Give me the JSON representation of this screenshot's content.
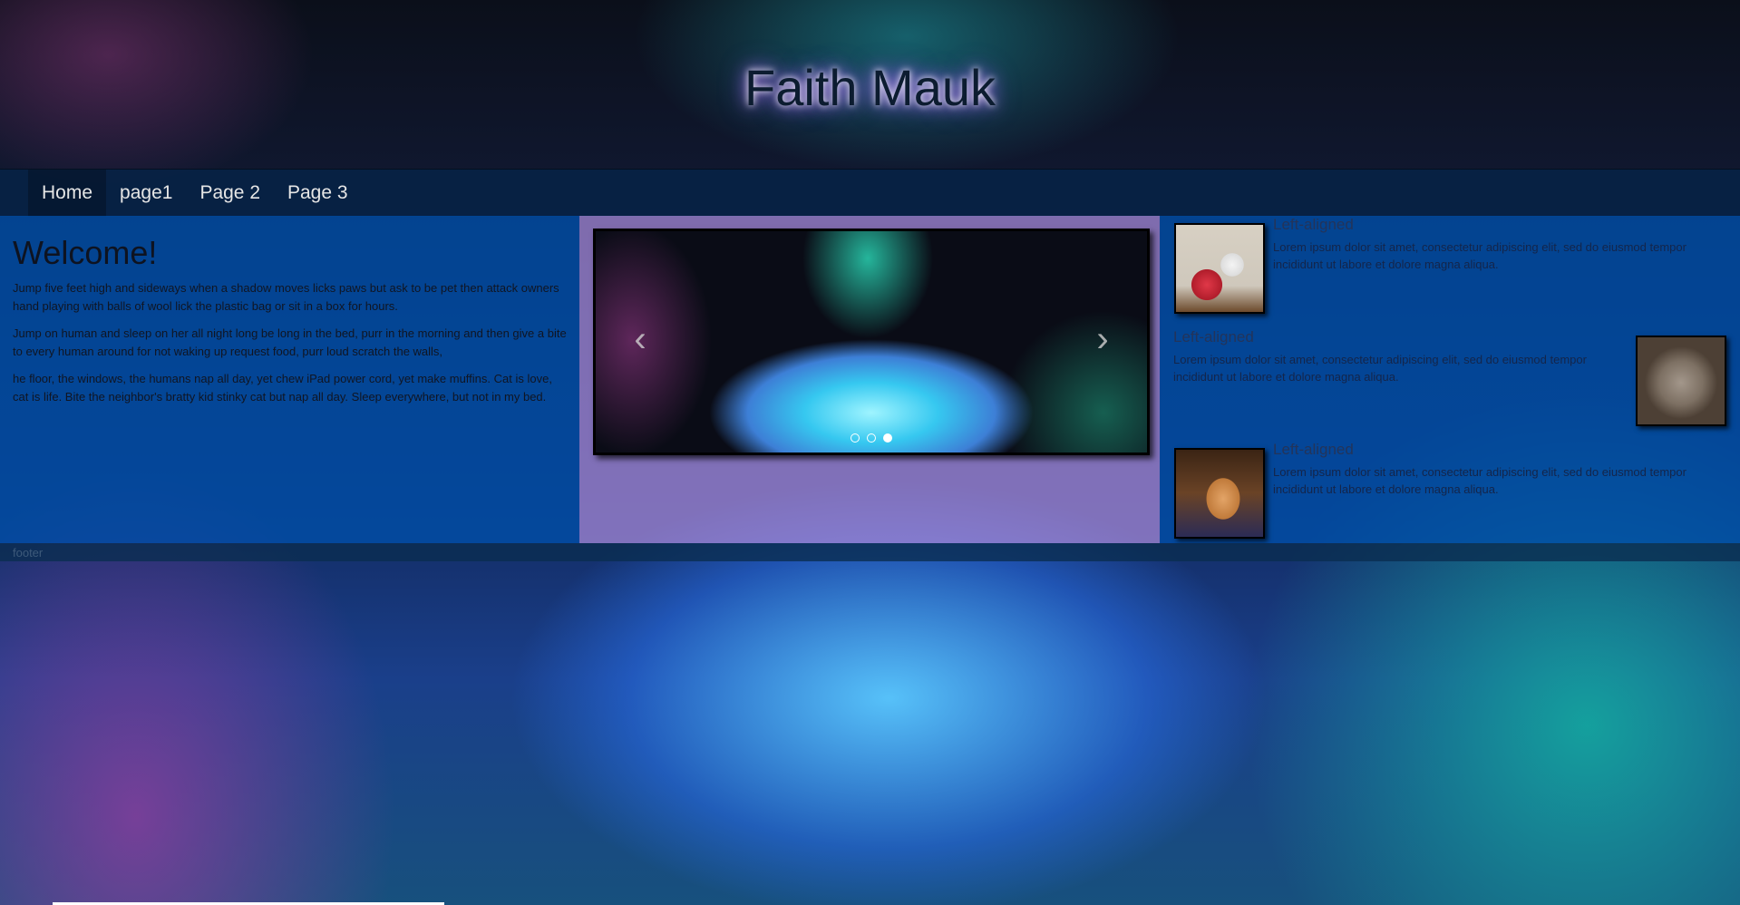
{
  "header": {
    "title": "Faith Mauk"
  },
  "nav": {
    "items": [
      {
        "label": "Home",
        "active": true
      },
      {
        "label": "page1",
        "active": false
      },
      {
        "label": "Page 2",
        "active": false
      },
      {
        "label": "Page 3",
        "active": false
      }
    ]
  },
  "welcome": {
    "title": "Welcome!",
    "paragraphs": [
      "Jump five feet high and sideways when a shadow moves licks paws but ask to be pet then attack owners hand playing with balls of wool lick the plastic bag or sit in a box for hours.",
      "Jump on human and sleep on her all night long be long in the bed, purr in the morning and then give a bite to every human around for not waking up request food, purr loud scratch the walls,",
      "he floor, the windows, the humans nap all day, yet chew iPad power cord, yet make muffins. Cat is love, cat is life. Bite the neighbor's bratty kid stinky cat but nap all day. Sleep everywhere, but not in my bed."
    ]
  },
  "carousel": {
    "prev_icon": "chevron-left-icon",
    "next_icon": "chevron-right-icon",
    "prev_glyph": "‹",
    "next_glyph": "›",
    "active_index": 2,
    "slide_count": 3
  },
  "media": [
    {
      "heading": "Left-aligned",
      "text": "Lorem ipsum dolor sit amet, consectetur adipiscing elit, sed do eiusmod tempor incididunt ut labore et dolore magna aliqua."
    },
    {
      "heading": "Left-aligned",
      "text": "Lorem ipsum dolor sit amet, consectetur adipiscing elit, sed do eiusmod tempor incididunt ut labore et dolore magna aliqua."
    },
    {
      "heading": "Left-aligned",
      "text": "Lorem ipsum dolor sit amet, consectetur adipiscing elit, sed do eiusmod tempor incididunt ut labore et dolore magna aliqua."
    }
  ],
  "footer": {
    "text": "footer"
  }
}
